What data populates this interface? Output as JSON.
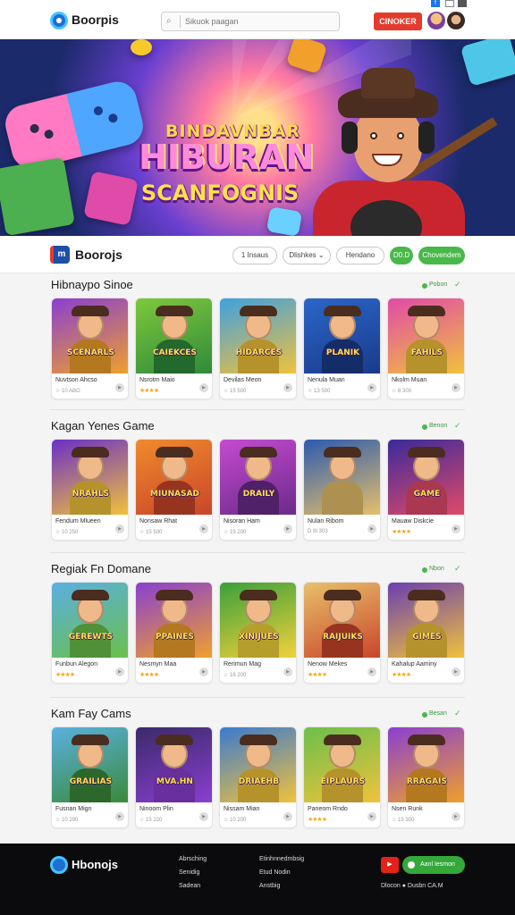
{
  "header": {
    "brand": "Boorpis",
    "search_placeholder": "Sikuok paagan",
    "login_label": "CINOKER"
  },
  "hero": {
    "line1": "BINDAVNBAR",
    "line2": "HIBURAN",
    "line3": "SCANFOGNIS"
  },
  "filterbar": {
    "brand": "Boorojs",
    "chips": [
      "1 Insaus",
      "Dlishkes",
      "Hendano"
    ],
    "green_chips": [
      "D0.D",
      "Chovendem"
    ]
  },
  "sections": [
    {
      "title": "Hibnaypo Sinoe",
      "more": "Pobon",
      "cards": [
        {
          "label": "SCENARLS",
          "name": "Nuvtson Ahcso",
          "meta": "☆ 10 ABO",
          "stars": false,
          "colors": [
            "#8a3fd1",
            "#f0a02b"
          ]
        },
        {
          "label": "CAIEKCES",
          "name": "Nsrotm Maio",
          "meta": "★★★★",
          "stars": true,
          "colors": [
            "#7ec83b",
            "#2f8a3a"
          ]
        },
        {
          "label": "HIDARCES",
          "name": "Devilas Meon",
          "meta": "☆ 15 500",
          "stars": false,
          "colors": [
            "#3fa0e0",
            "#f2c23b"
          ]
        },
        {
          "label": "PLANIK",
          "name": "Nenula Muan",
          "meta": "☆ 13 500",
          "stars": false,
          "colors": [
            "#2b66c9",
            "#1a3a8a"
          ]
        },
        {
          "label": "FAHILS",
          "name": "Nkolm Muan",
          "meta": "☆ 8 300",
          "stars": false,
          "colors": [
            "#e04aa8",
            "#f2c23b"
          ]
        }
      ]
    },
    {
      "title": "Kagan Yenes Game",
      "more": "Benon",
      "cards": [
        {
          "label": "NRAHLS",
          "name": "Fendum Mlueen",
          "meta": "☆ 10 250",
          "stars": false,
          "colors": [
            "#6a2fc8",
            "#f2c23b"
          ]
        },
        {
          "label": "MIUNASAD",
          "name": "Nonsaw Rhat",
          "meta": "☆ 15 500",
          "stars": false,
          "colors": [
            "#f08a2b",
            "#c9452a"
          ]
        },
        {
          "label": "DRAILY",
          "name": "Nisoran Ham",
          "meta": "☆ 15 200",
          "stars": false,
          "colors": [
            "#c64ad1",
            "#6a2a8a"
          ]
        },
        {
          "label": "",
          "name": "Nulan Ribom",
          "meta": "D 8I 303",
          "stars": false,
          "colors": [
            "#2a5ab0",
            "#e8c06a"
          ]
        },
        {
          "label": "GAME",
          "name": "Mauaw Diskcie",
          "meta": "★★★★",
          "stars": true,
          "colors": [
            "#3a2a9a",
            "#e24a6a"
          ]
        }
      ]
    },
    {
      "title": "Regiak Fn Domane",
      "more": "Nbon",
      "cards": [
        {
          "label": "GEREWTS",
          "name": "Funbun Alegon",
          "meta": "★★★★",
          "stars": true,
          "colors": [
            "#5ab0e0",
            "#6ac04a"
          ]
        },
        {
          "label": "PPAINES",
          "name": "Nesmyn Maa",
          "meta": "★★★★",
          "stars": true,
          "colors": [
            "#8a3fd1",
            "#f0a02b"
          ]
        },
        {
          "label": "XINIJUES",
          "name": "Rerimun Mag",
          "meta": "☆ 16 200",
          "stars": false,
          "colors": [
            "#3aa03a",
            "#f2d23b"
          ]
        },
        {
          "label": "RAIJUIKS",
          "name": "Nenow Mekes",
          "meta": "★★★★",
          "stars": true,
          "colors": [
            "#e8c06a",
            "#c9452a"
          ]
        },
        {
          "label": "GIMES",
          "name": "Kahalup Aaminy",
          "meta": "★★★★",
          "stars": true,
          "colors": [
            "#6a3fb0",
            "#f2c23b"
          ]
        }
      ]
    },
    {
      "title": "Kam Fay Cams",
      "more": "Besan",
      "cards": [
        {
          "label": "GRAILIAS",
          "name": "Fusnan Mign",
          "meta": "☆ 10 290",
          "stars": false,
          "colors": [
            "#5ab0e0",
            "#3a8a3a"
          ]
        },
        {
          "label": "MVA.HN",
          "name": "Ninoom Plin",
          "meta": "☆ 15 220",
          "stars": false,
          "colors": [
            "#3a2a6a",
            "#8a3fd1"
          ]
        },
        {
          "label": "DRIAEHB",
          "name": "Nissam Mian",
          "meta": "☆ 10 200",
          "stars": false,
          "colors": [
            "#3a7ad0",
            "#f2c23b"
          ]
        },
        {
          "label": "EIPLAURS",
          "name": "Paneom Rndo",
          "meta": "★★★★",
          "stars": true,
          "colors": [
            "#6ac04a",
            "#f2c23b"
          ]
        },
        {
          "label": "RRAGAIS",
          "name": "Nsen Runk",
          "meta": "☆ 15 300",
          "stars": false,
          "colors": [
            "#8a3fd1",
            "#f0a02b"
          ]
        }
      ]
    }
  ],
  "footer": {
    "brand": "Hbonojs",
    "col1": [
      "Abrsching",
      "Senidig",
      "Sadean"
    ],
    "col2": [
      "Etinhnnedmbsig",
      "Etud Nodin",
      "Anstbig"
    ],
    "cta_label": "Aanl Iesmon",
    "bottom": "Dlocon  ● Dusbn CA.M"
  }
}
